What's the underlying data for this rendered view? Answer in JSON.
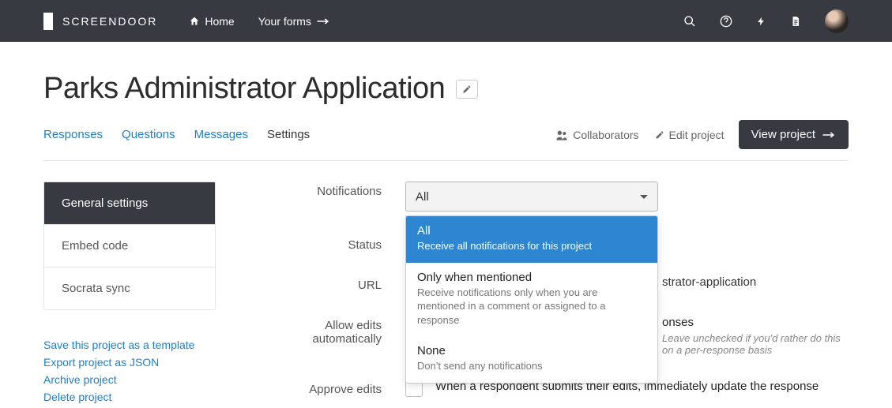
{
  "brand": "SCREENDOOR",
  "nav": {
    "home": "Home",
    "forms": "Your forms"
  },
  "title": "Parks Administrator Application",
  "tabs": {
    "responses": "Responses",
    "questions": "Questions",
    "messages": "Messages",
    "settings": "Settings"
  },
  "actions": {
    "collaborators": "Collaborators",
    "edit_project": "Edit project",
    "view_project": "View project"
  },
  "sidebar": {
    "items": [
      "General settings",
      "Embed code",
      "Socrata sync"
    ],
    "links": [
      "Save this project as a template",
      "Export project as JSON",
      "Archive project",
      "Delete project"
    ]
  },
  "form": {
    "notifications": {
      "label": "Notifications",
      "value": "All",
      "options": [
        {
          "title": "All",
          "desc": "Receive all notifications for this project"
        },
        {
          "title": "Only when mentioned",
          "desc": "Receive notifications only when you are mentioned in a comment or assigned to a response"
        },
        {
          "title": "None",
          "desc": "Don't send any notifications"
        }
      ]
    },
    "status": {
      "label": "Status"
    },
    "url": {
      "label": "URL",
      "suffix": "strator-application"
    },
    "allow_edits": {
      "label1": "Allow edits",
      "label2": "automatically",
      "text_suffix": "onses",
      "sub": "Leave unchecked if you'd rather do this on a per-response basis"
    },
    "approve_edits": {
      "label1": "Approve edits",
      "text": "When a respondent submits their edits, immediately update the response"
    }
  }
}
